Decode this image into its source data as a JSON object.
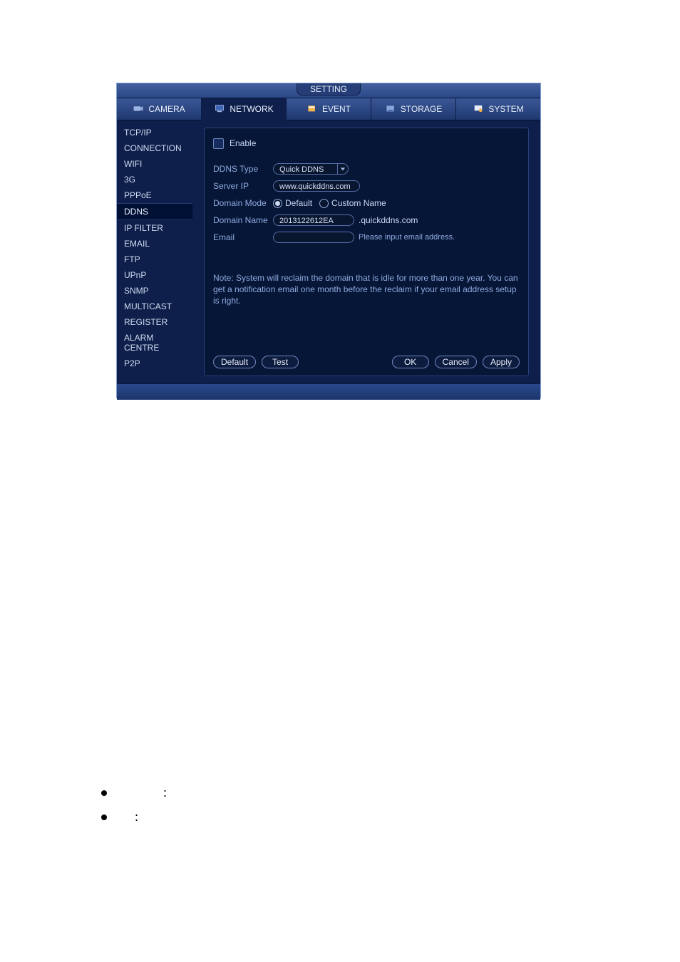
{
  "window": {
    "title": "SETTING"
  },
  "tabs": {
    "camera": {
      "label": "CAMERA"
    },
    "network": {
      "label": "NETWORK"
    },
    "event": {
      "label": "EVENT"
    },
    "storage": {
      "label": "STORAGE"
    },
    "system": {
      "label": "SYSTEM"
    }
  },
  "sidebar": {
    "items": [
      {
        "label": "TCP/IP"
      },
      {
        "label": "CONNECTION"
      },
      {
        "label": "WIFI"
      },
      {
        "label": "3G"
      },
      {
        "label": "PPPoE"
      },
      {
        "label": "DDNS"
      },
      {
        "label": "IP FILTER"
      },
      {
        "label": "EMAIL"
      },
      {
        "label": "FTP"
      },
      {
        "label": "UPnP"
      },
      {
        "label": "SNMP"
      },
      {
        "label": "MULTICAST"
      },
      {
        "label": "REGISTER"
      },
      {
        "label": "ALARM CENTRE"
      },
      {
        "label": "P2P"
      }
    ],
    "selected_index": 5
  },
  "form": {
    "enable": {
      "label": "Enable",
      "checked": false
    },
    "ddns_type": {
      "label": "DDNS Type",
      "value": "Quick DDNS"
    },
    "server_ip": {
      "label": "Server IP",
      "value": "www.quickddns.com"
    },
    "domain_mode": {
      "label": "Domain Mode",
      "options": {
        "default": "Default",
        "custom": "Custom Name"
      },
      "selected": "default"
    },
    "domain_name": {
      "label": "Domain Name",
      "value": "2013122612EA",
      "suffix": ".quickddns.com"
    },
    "email": {
      "label": "Email",
      "value": "",
      "hint": "Please input email address."
    }
  },
  "note": "Note: System will reclaim the domain that is idle for more than one year. You can get a notification email one month before the reclaim if your email address setup is right.",
  "buttons": {
    "default": "Default",
    "test": "Test",
    "ok": "OK",
    "cancel": "Cancel",
    "apply": "Apply"
  },
  "bullets": {
    "item0": "：",
    "item1": "："
  }
}
